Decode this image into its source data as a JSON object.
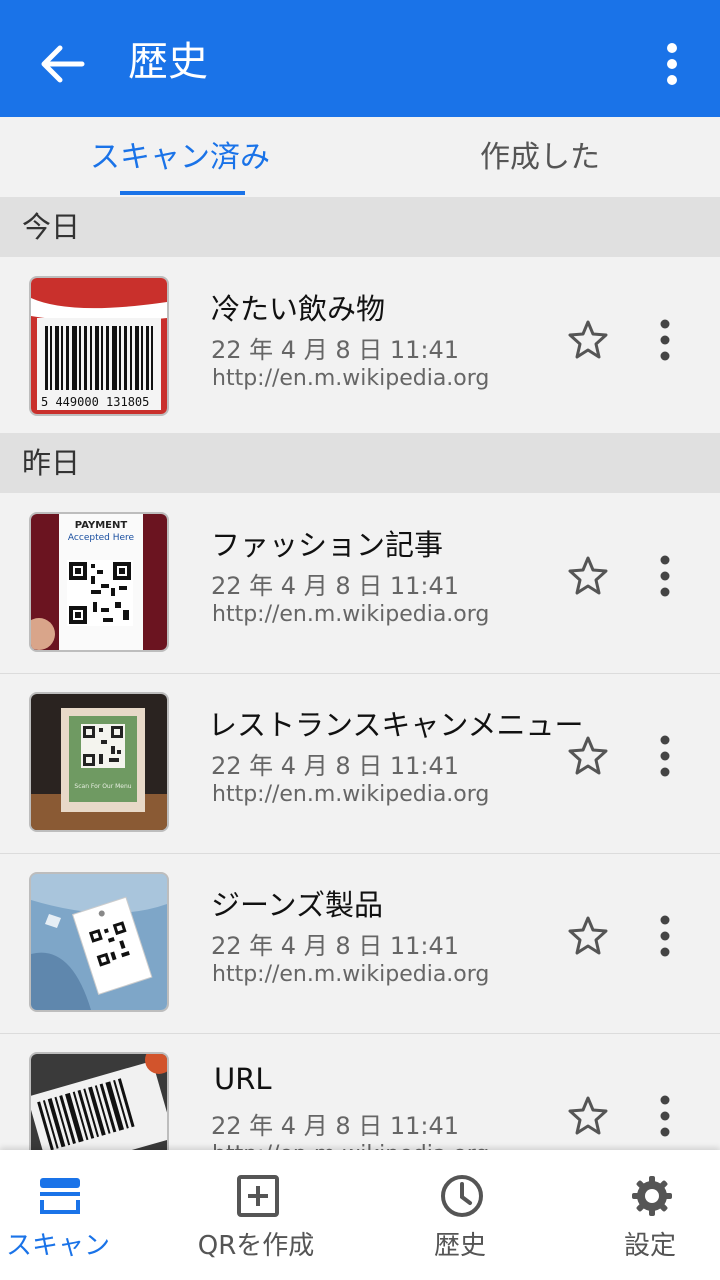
{
  "appbar": {
    "title": "歴史",
    "back_icon": "arrow-back-icon",
    "more_icon": "more-vert-icon"
  },
  "tabs": [
    {
      "label": "スキャン済み",
      "active": true
    },
    {
      "label": "作成した",
      "active": false
    }
  ],
  "sections": [
    {
      "label": "今日"
    },
    {
      "label": "昨日"
    }
  ],
  "items": [
    {
      "title": "冷たい飲み物",
      "date": "22 年 4 月 8 日 11:41",
      "url": "http://en.m.wikipedia.org",
      "thumb": "barcode-can",
      "barcode_text": "5 449000 131805"
    },
    {
      "title": "ファッション記事",
      "date": "22 年 4 月 8 日 11:41",
      "url": "http://en.m.wikipedia.org",
      "thumb": "qr-payment",
      "card_line1": "PAYMENT",
      "card_line2": "Accepted Here"
    },
    {
      "title": "レストランスキャンメニュー",
      "date": "22 年 4 月 8 日 11:41",
      "url": "http://en.m.wikipedia.org",
      "thumb": "qr-frame",
      "frame_caption": "Scan For Our Menu"
    },
    {
      "title": "ジーンズ製品",
      "date": "22 年 4 月 8 日 11:41",
      "url": "http://en.m.wikipedia.org",
      "thumb": "qr-jeans-tag"
    },
    {
      "title": "URL",
      "date": "22 年 4 月 8 日 11:41",
      "url": "http://en.m.wikipedia.org",
      "thumb": "barcode-label"
    }
  ],
  "nav": [
    {
      "label": "スキャン",
      "icon": "scan-icon",
      "active": true
    },
    {
      "label": "QRを作成",
      "icon": "add-box-icon",
      "active": false
    },
    {
      "label": "歴史",
      "icon": "clock-icon",
      "active": false
    },
    {
      "label": "設定",
      "icon": "gear-icon",
      "active": false
    }
  ],
  "colors": {
    "primary": "#1a73e8",
    "background": "#f2f2f2",
    "section": "#e0e0e0"
  }
}
